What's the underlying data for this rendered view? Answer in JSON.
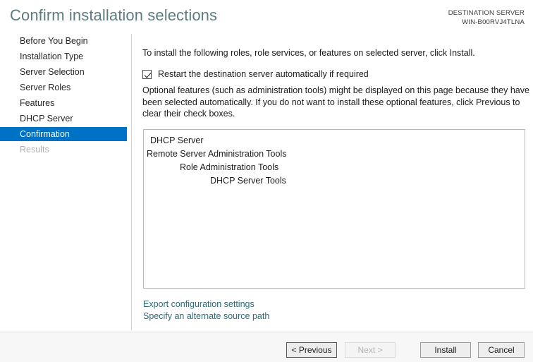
{
  "header": {
    "title": "Confirm installation selections",
    "destination_label": "DESTINATION SERVER",
    "destination_server": "WIN-B00RVJ4TLNA"
  },
  "sidebar": {
    "items": [
      {
        "label": "Before You Begin",
        "state": "normal"
      },
      {
        "label": "Installation Type",
        "state": "normal"
      },
      {
        "label": "Server Selection",
        "state": "normal"
      },
      {
        "label": "Server Roles",
        "state": "normal"
      },
      {
        "label": "Features",
        "state": "normal"
      },
      {
        "label": "DHCP Server",
        "state": "normal"
      },
      {
        "label": "Confirmation",
        "state": "selected"
      },
      {
        "label": "Results",
        "state": "disabled"
      }
    ]
  },
  "main": {
    "intro_text": "To install the following roles, role services, or features on selected server, click Install.",
    "restart_checkbox_label": "Restart the destination server automatically if required",
    "restart_checkbox_checked": true,
    "optional_text": "Optional features (such as administration tools) might be displayed on this page because they have been selected automatically. If you do not want to install these optional features, click Previous to clear their check boxes.",
    "features": [
      {
        "label": "DHCP Server",
        "indent": 0
      },
      {
        "label": "Remote Server Administration Tools",
        "indent": 0
      },
      {
        "label": "Role Administration Tools",
        "indent": 1
      },
      {
        "label": "DHCP Server Tools",
        "indent": 2
      }
    ],
    "links": [
      {
        "label": "Export configuration settings"
      },
      {
        "label": "Specify an alternate source path"
      }
    ]
  },
  "footer": {
    "previous_label": "< Previous",
    "next_label": "Next >",
    "install_label": "Install",
    "cancel_label": "Cancel"
  },
  "colors": {
    "title": "#5d7c80",
    "selection": "#0072c6",
    "link": "#2d6a72",
    "disabled_text": "#b0b0b0"
  }
}
